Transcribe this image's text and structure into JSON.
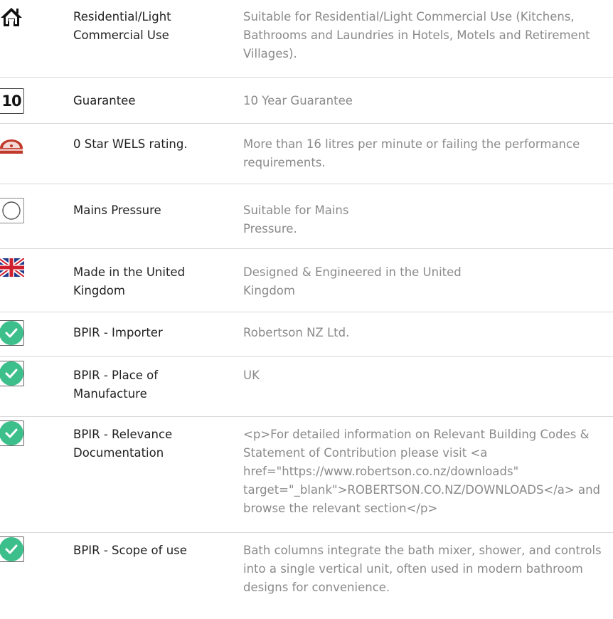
{
  "colors": {
    "name_text": "#222222",
    "description_text": "#8a8a8a",
    "divider": "#d8d8d8",
    "check_green": "#3dbf8c"
  },
  "features": [
    {
      "icon": "house-icon",
      "name": "Residential/Light Commercial Use",
      "description": "Suitable for Residential/Light Commercial Use (Kitchens, Bathrooms and Laundries in Hotels, Motels and Retirement Villages)."
    },
    {
      "icon": "ten-year-icon",
      "icon_text": "10",
      "name": "Guarantee",
      "description": "10 Year Guarantee"
    },
    {
      "icon": "wels-rating-icon",
      "name": "0 Star WELS rating.",
      "description": "More than 16 litres per minute or failing the performance requirements."
    },
    {
      "icon": "pressure-circle-icon",
      "name": "Mains Pressure",
      "description": "Suitable for Mains\nPressure."
    },
    {
      "icon": "uk-flag-icon",
      "name": "Made in the United Kingdom",
      "description": "Designed & Engineered in the United\nKingdom"
    },
    {
      "icon": "check-circle-icon",
      "name": "BPIR - Importer",
      "description": "Robertson NZ Ltd."
    },
    {
      "icon": "check-circle-icon",
      "name": "BPIR - Place of Manufacture",
      "description": "UK"
    },
    {
      "icon": "check-circle-icon",
      "name": "BPIR - Relevance Documentation",
      "description": "<p>For detailed information on Relevant Building Codes & Statement of Contribution please visit <a href=\"https://www.robertson.co.nz/downloads\" target=\"_blank\">ROBERTSON.CO.NZ/DOWNLOADS</a> and browse the relevant section</p>"
    },
    {
      "icon": "check-circle-icon",
      "name": "BPIR - Scope of use",
      "description": "Bath columns integrate the bath mixer, shower, and controls into a single vertical unit, often used in modern bathroom designs for convenience."
    }
  ]
}
